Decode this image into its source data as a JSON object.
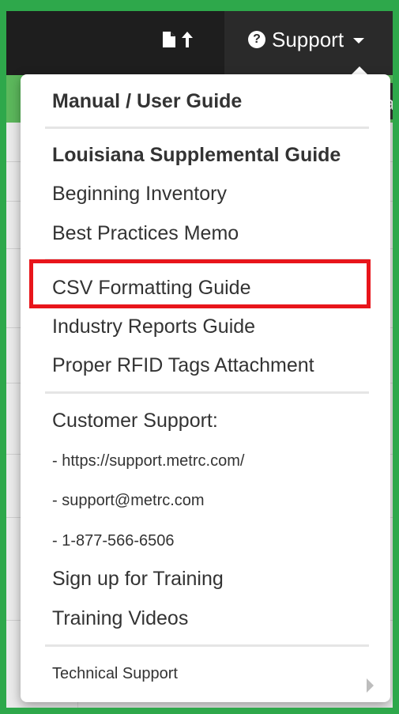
{
  "nav": {
    "support_label": "Support"
  },
  "menu": {
    "manual_guide": "Manual / User Guide",
    "state_guide": "Louisiana Supplemental Guide",
    "beginning_inventory": "Beginning Inventory",
    "best_practices": "Best Practices Memo",
    "csv_guide": "CSV Formatting Guide",
    "industry_reports": "Industry Reports Guide",
    "rfid_tags": "Proper RFID Tags Attachment",
    "customer_support_header": "Customer Support:",
    "support_url": "- https://support.metrc.com/",
    "support_email": "- support@metrc.com",
    "support_phone": "- 1-877-566-6506",
    "training_signup": "Sign up for Training",
    "training_videos": "Training Videos",
    "technical_support": "Technical Support"
  },
  "background": {
    "partial_letter": "a",
    "partial_colon": ":"
  },
  "colors": {
    "frame_green": "#2ea84b",
    "highlight_red": "#e8151b",
    "navbar": "#1e1e1e"
  }
}
